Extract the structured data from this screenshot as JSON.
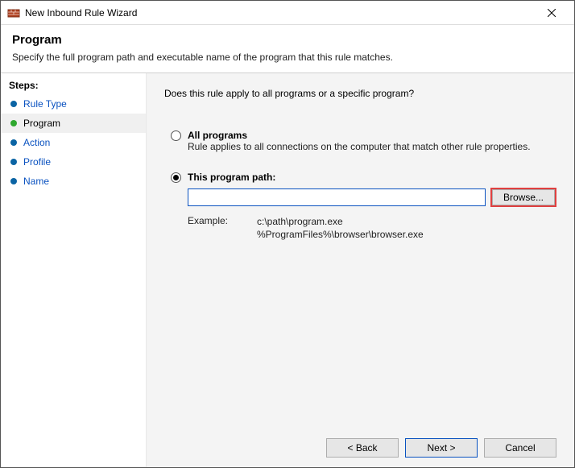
{
  "window": {
    "title": "New Inbound Rule Wizard"
  },
  "header": {
    "title": "Program",
    "subtitle": "Specify the full program path and executable name of the program that this rule matches."
  },
  "sidebar": {
    "title": "Steps:",
    "items": [
      {
        "label": "Rule Type",
        "state": "link",
        "bullet": "blue"
      },
      {
        "label": "Program",
        "state": "current",
        "bullet": "green"
      },
      {
        "label": "Action",
        "state": "link",
        "bullet": "blue"
      },
      {
        "label": "Profile",
        "state": "link",
        "bullet": "blue"
      },
      {
        "label": "Name",
        "state": "link",
        "bullet": "blue"
      }
    ]
  },
  "content": {
    "question": "Does this rule apply to all programs or a specific program?",
    "option_all": {
      "label": "All programs",
      "desc": "Rule applies to all connections on the computer that match other rule properties."
    },
    "option_path": {
      "label": "This program path:",
      "value": "",
      "browse": "Browse...",
      "example_label": "Example:",
      "example_paths": "c:\\path\\program.exe\n%ProgramFiles%\\browser\\browser.exe"
    }
  },
  "footer": {
    "back": "< Back",
    "next": "Next >",
    "cancel": "Cancel"
  }
}
